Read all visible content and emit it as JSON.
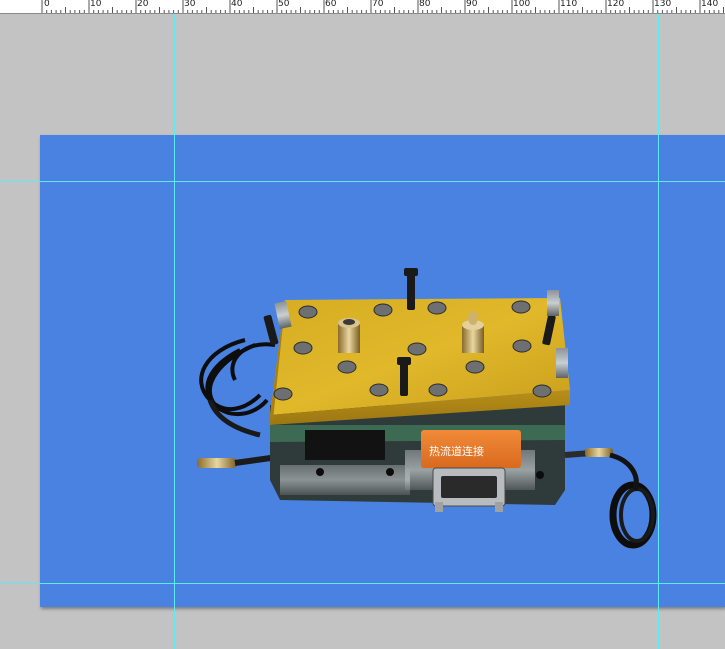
{
  "ruler": {
    "labels": [
      "0",
      "10",
      "20",
      "30",
      "40",
      "50",
      "60",
      "70",
      "80",
      "90",
      "100",
      "110",
      "120",
      "130",
      "140"
    ]
  },
  "canvas": {
    "background_color": "#c3c3c3",
    "document_color": "#4a82e2",
    "guide_color": "#5fe9f0"
  },
  "photo": {
    "subject": "yellow mold plate with orange connector housing and black cables",
    "connector_label_text": "热流道连接"
  }
}
